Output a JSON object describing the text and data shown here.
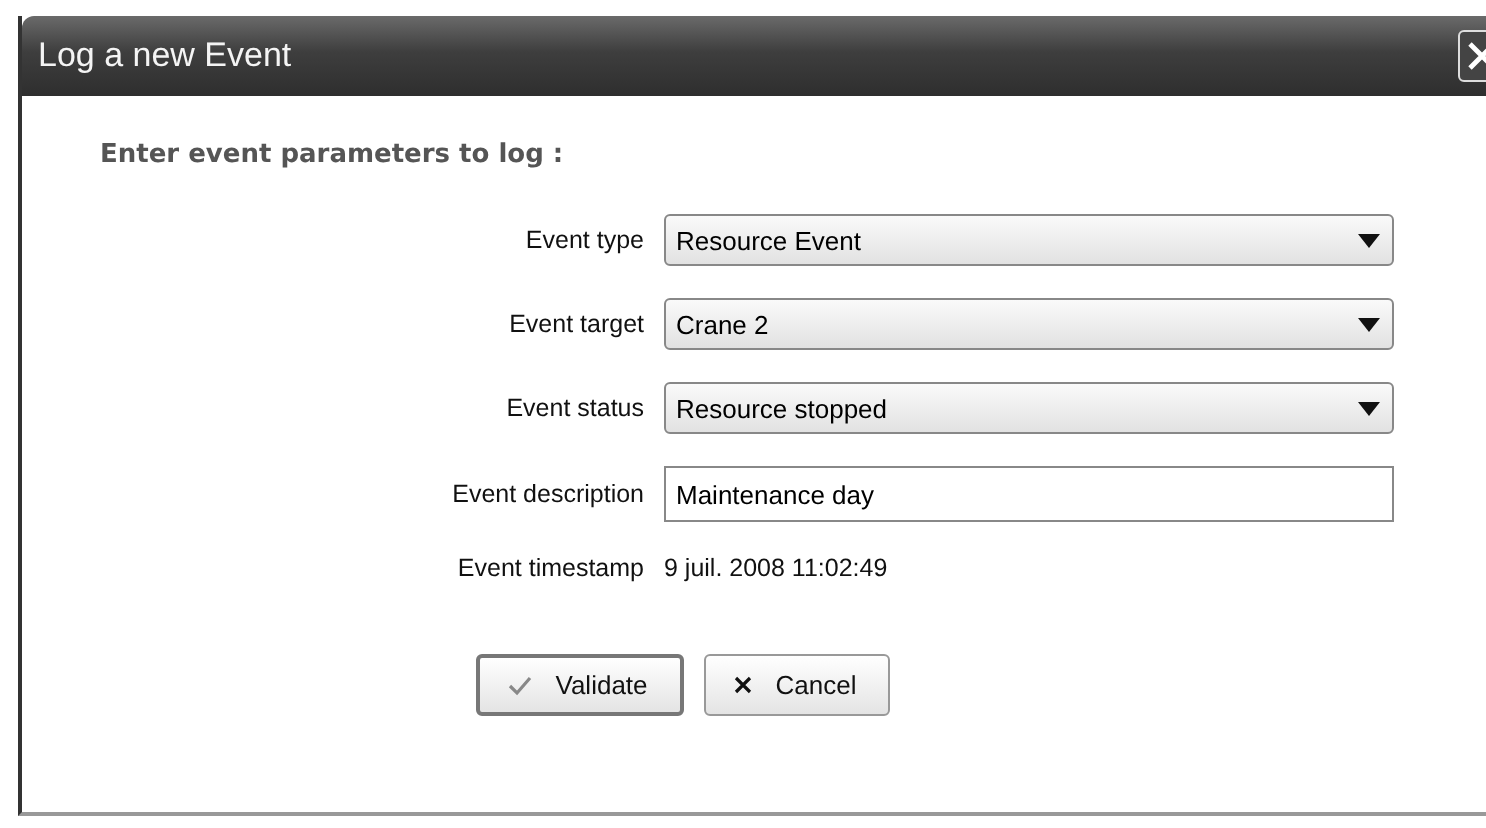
{
  "window": {
    "title": "Log a new Event"
  },
  "heading": "Enter event parameters to log :",
  "fields": [
    {
      "label": "Event type",
      "kind": "select",
      "value": "Resource Event"
    },
    {
      "label": "Event target",
      "kind": "select",
      "value": "Crane 2"
    },
    {
      "label": "Event status",
      "kind": "select",
      "value": "Resource stopped"
    },
    {
      "label": "Event description",
      "kind": "text",
      "value": "Maintenance day "
    },
    {
      "label": "Event timestamp",
      "kind": "static",
      "value": "9 juil. 2008 11:02:49"
    }
  ],
  "buttons": [
    {
      "label": "Validate",
      "kind": "ok",
      "focused": true
    },
    {
      "label": "Cancel",
      "kind": "cancel",
      "focused": false
    }
  ]
}
